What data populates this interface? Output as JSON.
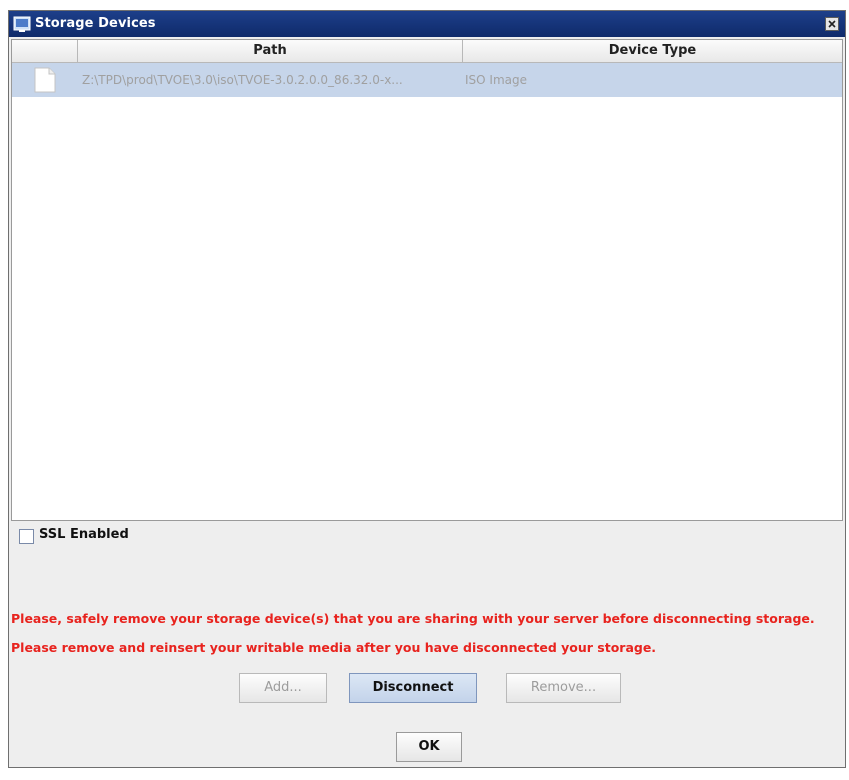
{
  "window": {
    "title": "Storage Devices"
  },
  "table": {
    "columns": [
      "",
      "Path",
      "Device Type"
    ],
    "rows": [
      {
        "path": "Z:\\TPD\\prod\\TVOE\\3.0\\iso\\TVOE-3.0.2.0.0_86.32.0-x...",
        "device_type": "ISO Image",
        "selected": true
      }
    ]
  },
  "ssl": {
    "label": "SSL Enabled",
    "checked": false
  },
  "warnings": [
    "Please, safely remove your storage device(s) that you are sharing with your server before disconnecting storage.",
    "Please remove and reinsert your writable media after you have disconnected your storage."
  ],
  "buttons": {
    "add": "Add...",
    "disconnect": "Disconnect",
    "remove": "Remove...",
    "ok": "OK"
  },
  "colors": {
    "title_bar": "#1d3f8a",
    "selection": "#c6d5ea",
    "warning_text": "#e8231e"
  }
}
